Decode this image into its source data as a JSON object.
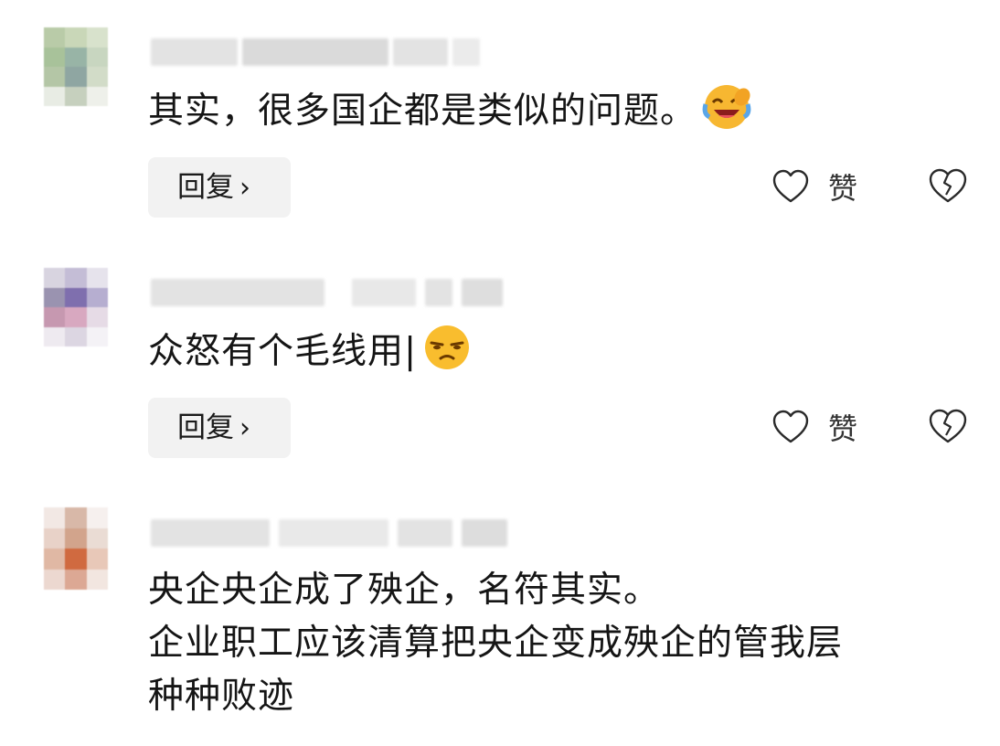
{
  "comments": [
    {
      "text_lines": [
        "其实，很多国企都是类似的问题。"
      ],
      "emoji": "laughing-crying-emoji",
      "reply_label": "回复",
      "reply_chevron": "›",
      "like_label": "赞"
    },
    {
      "text_lines": [
        "众怒有个毛线用|"
      ],
      "emoji": "annoyed-face-emoji",
      "reply_label": "回复",
      "reply_chevron": "›",
      "like_label": "赞"
    },
    {
      "text_lines": [
        "央企央企成了殃企，名符其实。",
        "企业职工应该清算把央企变成殃企的管我层",
        "种种败迹"
      ]
    }
  ],
  "icons": {
    "like": "heart-outline-icon",
    "dislike": "broken-heart-icon"
  },
  "colors": {
    "text": "#151515",
    "reply_bg": "#f2f2f2",
    "emoji_yellow": "#f7b731"
  }
}
